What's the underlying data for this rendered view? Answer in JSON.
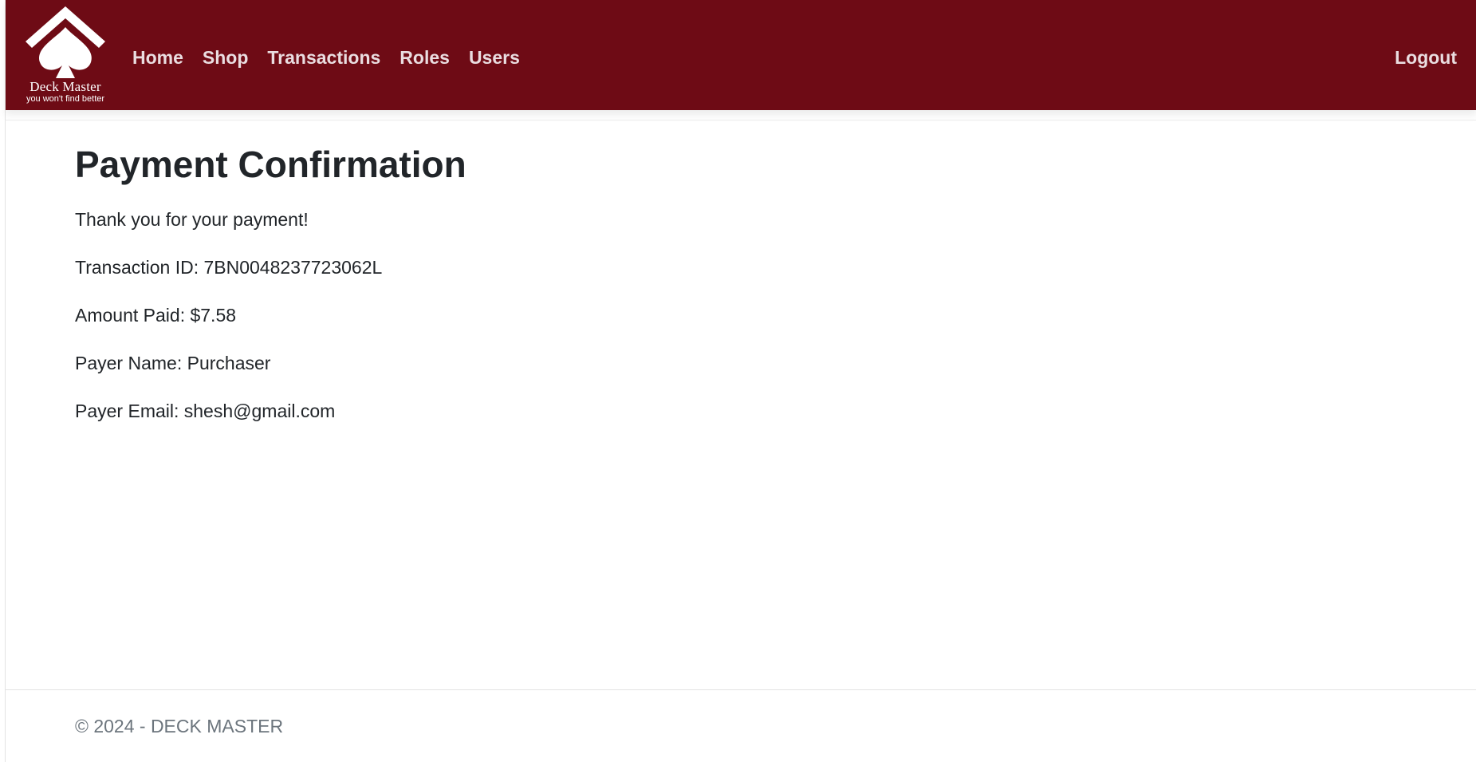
{
  "brand": {
    "name": "Deck Master",
    "tagline": "you won't find better",
    "icon": "spade-icon"
  },
  "nav": {
    "links": [
      "Home",
      "Shop",
      "Transactions",
      "Roles",
      "Users"
    ],
    "logout": "Logout"
  },
  "main": {
    "title": "Payment Confirmation",
    "thank_you": "Thank you for your payment!",
    "transaction_id": "Transaction ID: 7BN0048237723062L",
    "amount_paid": "Amount Paid: $7.58",
    "payer_name": "Payer Name: Purchaser",
    "payer_email": "Payer Email: shesh@gmail.com"
  },
  "footer": {
    "text": "© 2024 - DECK MASTER"
  },
  "colors": {
    "navbar": "#6e0b15",
    "nav_text": "#eadde0",
    "footer_text": "#6c757d"
  }
}
